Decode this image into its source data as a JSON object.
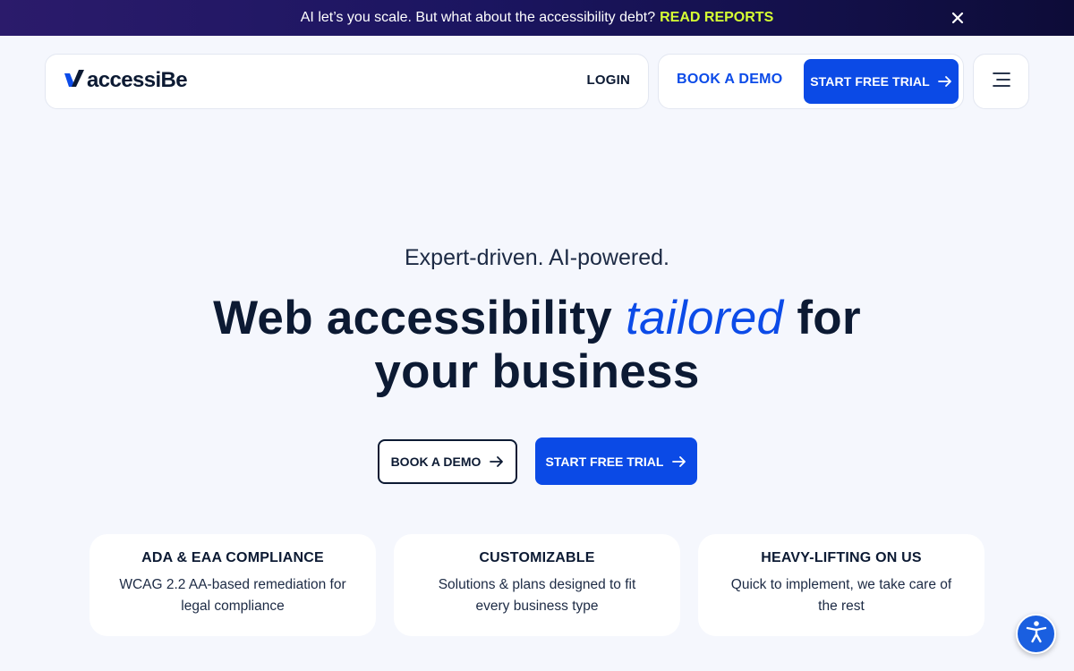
{
  "announcement": {
    "text": "AI let’s you scale. But what about the accessibility debt?",
    "link": "READ REPORTS",
    "close_icon": "close-icon"
  },
  "header": {
    "logo_text": "accessiBe",
    "login": "LOGIN",
    "book_demo": "BOOK A DEMO",
    "start_trial": "START FREE TRIAL",
    "menu_icon": "hamburger-menu-icon"
  },
  "hero": {
    "eyebrow": "Expert-driven. AI-powered.",
    "headline_pre": "Web accessibility",
    "headline_accent": "tailored",
    "headline_post": "for",
    "headline_line2": "your business",
    "book_demo": "BOOK A DEMO",
    "start_trial": "START FREE TRIAL"
  },
  "features": [
    {
      "title": "ADA & EAA COMPLIANCE",
      "desc": "WCAG 2.2 AA-based remediation for legal compliance"
    },
    {
      "title": "CUSTOMIZABLE",
      "desc": "Solutions & plans designed to fit every business type"
    },
    {
      "title": "HEAVY-LIFTING ON US",
      "desc": "Quick to implement, we take care of the rest"
    }
  ],
  "widget": {
    "icon": "accessibility-icon"
  },
  "colors": {
    "brand_blue": "#0b4ae6",
    "navy": "#0c1a33",
    "announce_link": "#d6ff33",
    "background": "#f5f7fd"
  }
}
